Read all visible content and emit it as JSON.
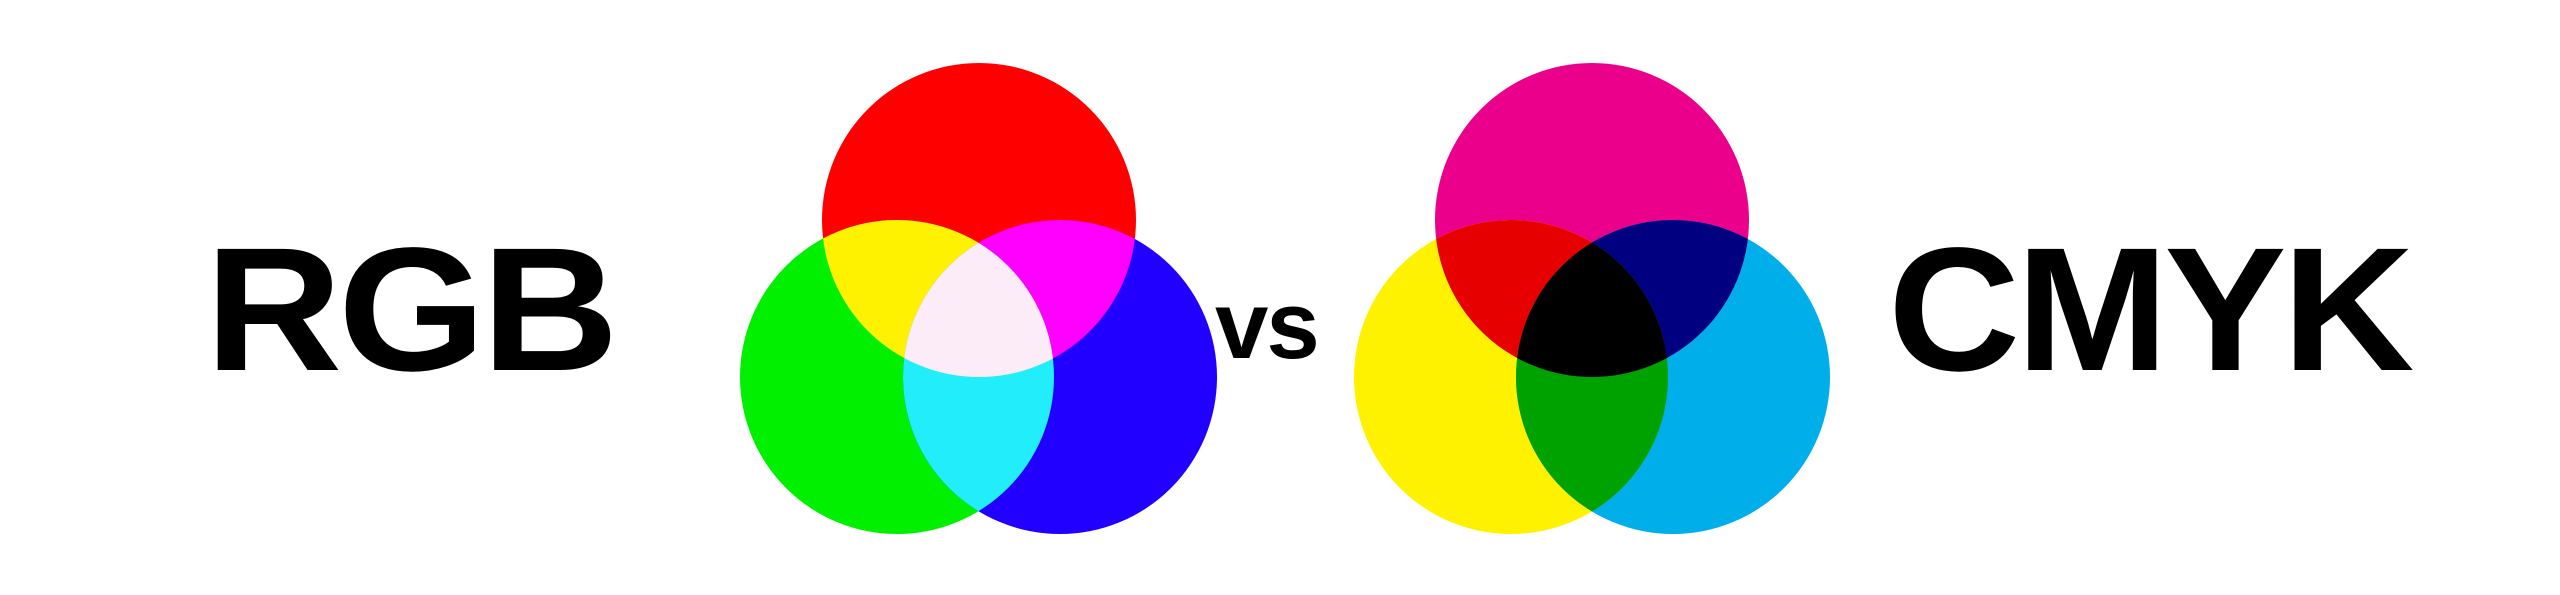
{
  "labels": {
    "left": "RGB",
    "middle": "vs",
    "right": "CMYK"
  },
  "rgb_diagram": {
    "circles": [
      {
        "name": "red",
        "color": "#ff0000"
      },
      {
        "name": "green",
        "color": "#00f000"
      },
      {
        "name": "blue",
        "color": "#2200ff"
      }
    ],
    "overlaps": {
      "red_green": "#fff200",
      "red_blue": "#ff00ff",
      "green_blue": "#22eefb",
      "center": "#fbecf7"
    }
  },
  "cmyk_diagram": {
    "circles": [
      {
        "name": "magenta",
        "color": "#ea008b"
      },
      {
        "name": "yellow",
        "color": "#fff200"
      },
      {
        "name": "cyan",
        "color": "#00aeea"
      }
    ],
    "overlaps": {
      "magenta_yellow": "#e60000",
      "magenta_cyan": "#010080",
      "yellow_cyan": "#00a200",
      "center": "#000000"
    }
  }
}
